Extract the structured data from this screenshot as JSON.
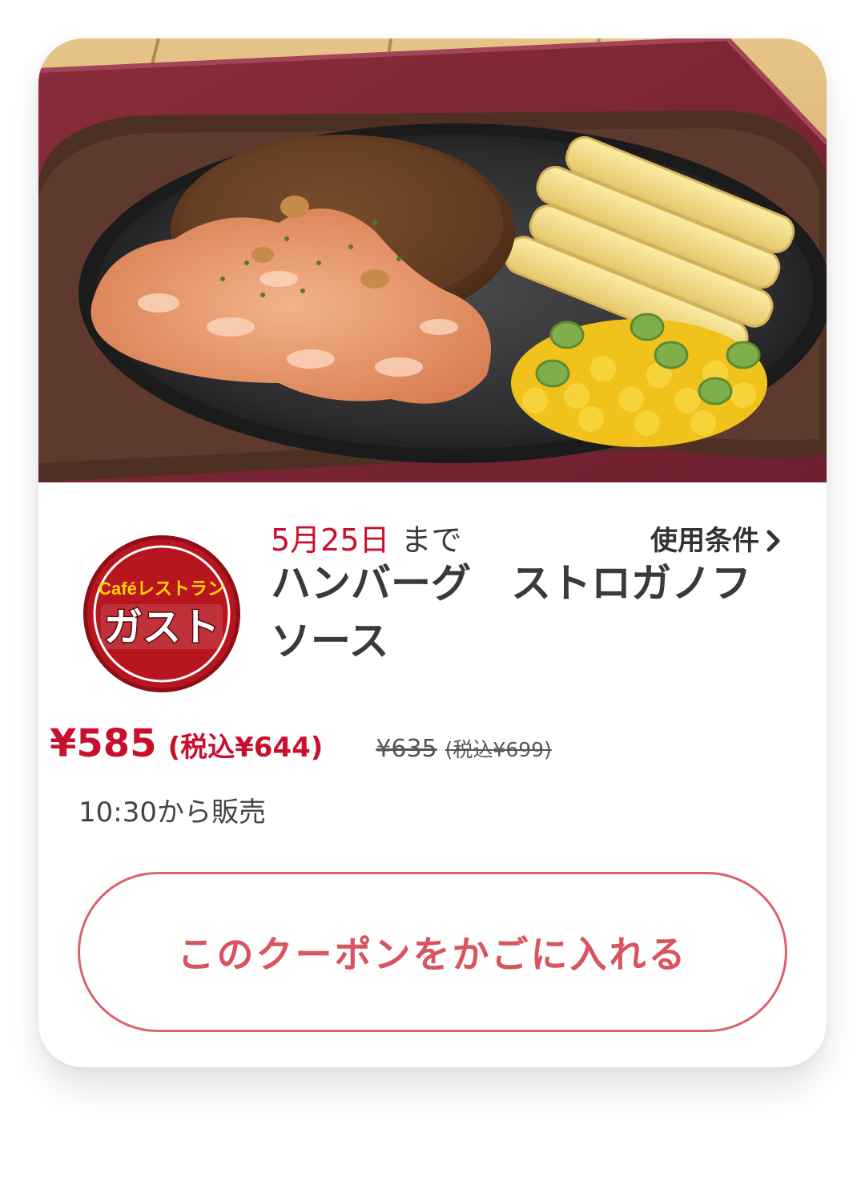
{
  "card": {
    "photo_alt": "ハンバーグ ストロガノフソース",
    "logo": {
      "top_text": "Caféレストラン",
      "brand_text": "ガスト",
      "bg_color": "#b8161f",
      "ring_color": "#ffffff",
      "top_text_color": "#ffd400"
    },
    "expiry": {
      "date": "5月25日",
      "suffix": "まで"
    },
    "terms_link": "使用条件",
    "title": "ハンバーグ　ストロガノフ\nソース",
    "price": {
      "current": "¥585",
      "current_tax": "(税込¥644)",
      "original": "¥635",
      "original_tax": "(税込¥699)"
    },
    "sale_time": "10:30から販売",
    "cart_button": "このクーポンをかごに入れる"
  },
  "colors": {
    "accent_red": "#c8102e",
    "button_pink": "#d8545f",
    "text_dark": "#3a3a3a"
  }
}
